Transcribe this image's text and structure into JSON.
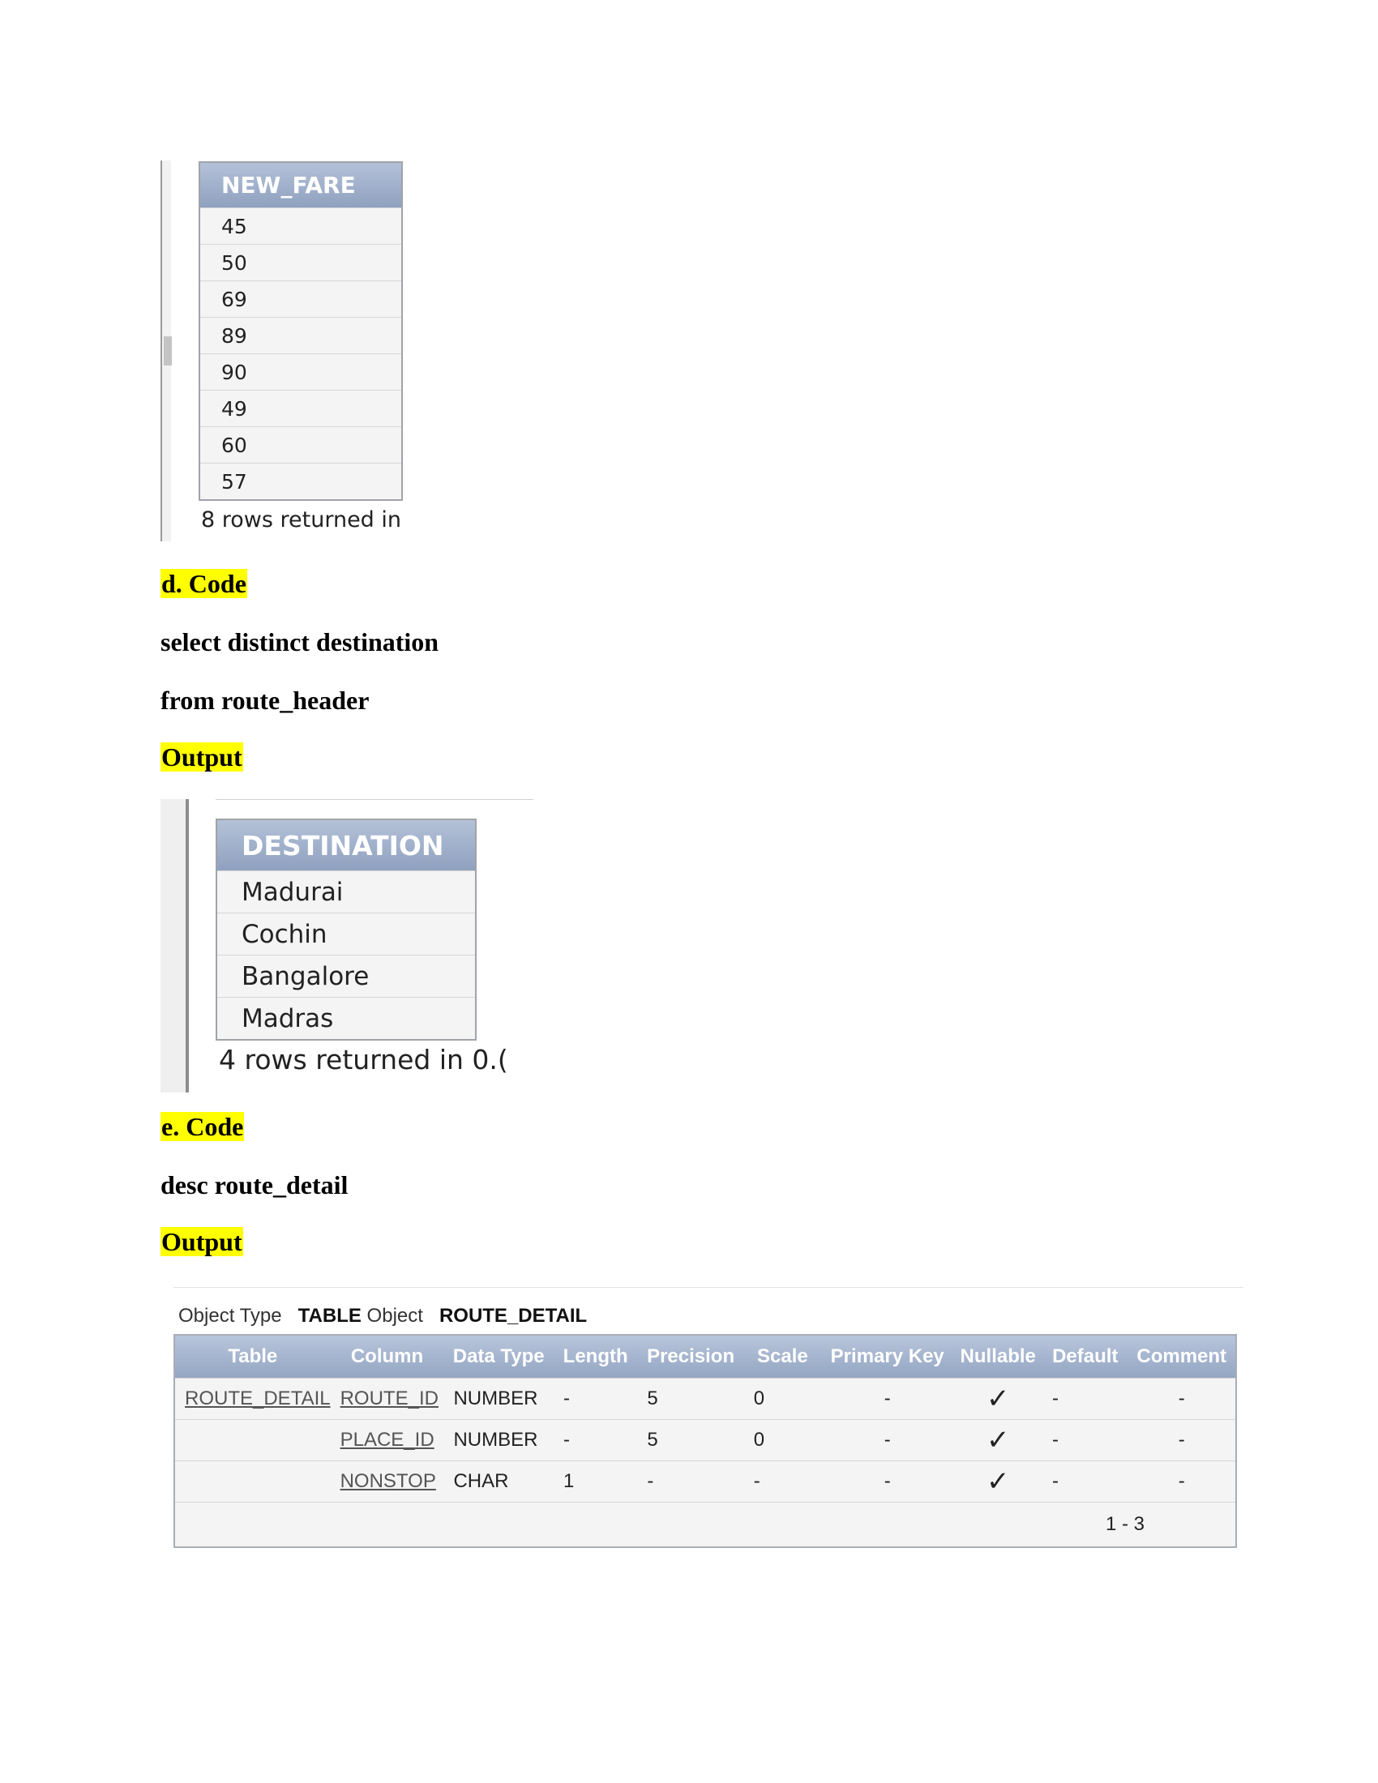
{
  "output1": {
    "column": "NEW_FARE",
    "rows": [
      "45",
      "50",
      "69",
      "89",
      "90",
      "49",
      "60",
      "57"
    ],
    "footer": "8 rows returned in"
  },
  "section_d": {
    "heading": "d. Code",
    "code_lines": [
      "select distinct destination",
      "from route_header"
    ],
    "output_label": "Output"
  },
  "output2": {
    "column": "DESTINATION",
    "rows": [
      "Madurai",
      "Cochin",
      "Bangalore",
      "Madras"
    ],
    "footer": "4 rows returned in 0.("
  },
  "section_e": {
    "heading": "e. Code",
    "code_lines": [
      "desc route_detail"
    ],
    "output_label": "Output"
  },
  "output3": {
    "object_type_label": "Object Type",
    "object_type_value": "TABLE",
    "object_label": "Object",
    "object_value": "ROUTE_DETAIL",
    "headers": [
      "Table",
      "Column",
      "Data Type",
      "Length",
      "Precision",
      "Scale",
      "Primary Key",
      "Nullable",
      "Default",
      "Comment"
    ],
    "rows": [
      {
        "table": "ROUTE_DETAIL",
        "column": "ROUTE_ID",
        "data_type": "NUMBER",
        "length": "-",
        "precision": "5",
        "scale": "0",
        "primary_key": "-",
        "nullable": "✓",
        "default": "-",
        "comment": "-"
      },
      {
        "table": "",
        "column": "PLACE_ID",
        "data_type": "NUMBER",
        "length": "-",
        "precision": "5",
        "scale": "0",
        "primary_key": "-",
        "nullable": "✓",
        "default": "-",
        "comment": "-"
      },
      {
        "table": "",
        "column": "NONSTOP",
        "data_type": "CHAR",
        "length": "1",
        "precision": "-",
        "scale": "-",
        "primary_key": "-",
        "nullable": "✓",
        "default": "-",
        "comment": "-"
      }
    ],
    "pagination": "1 - 3"
  }
}
